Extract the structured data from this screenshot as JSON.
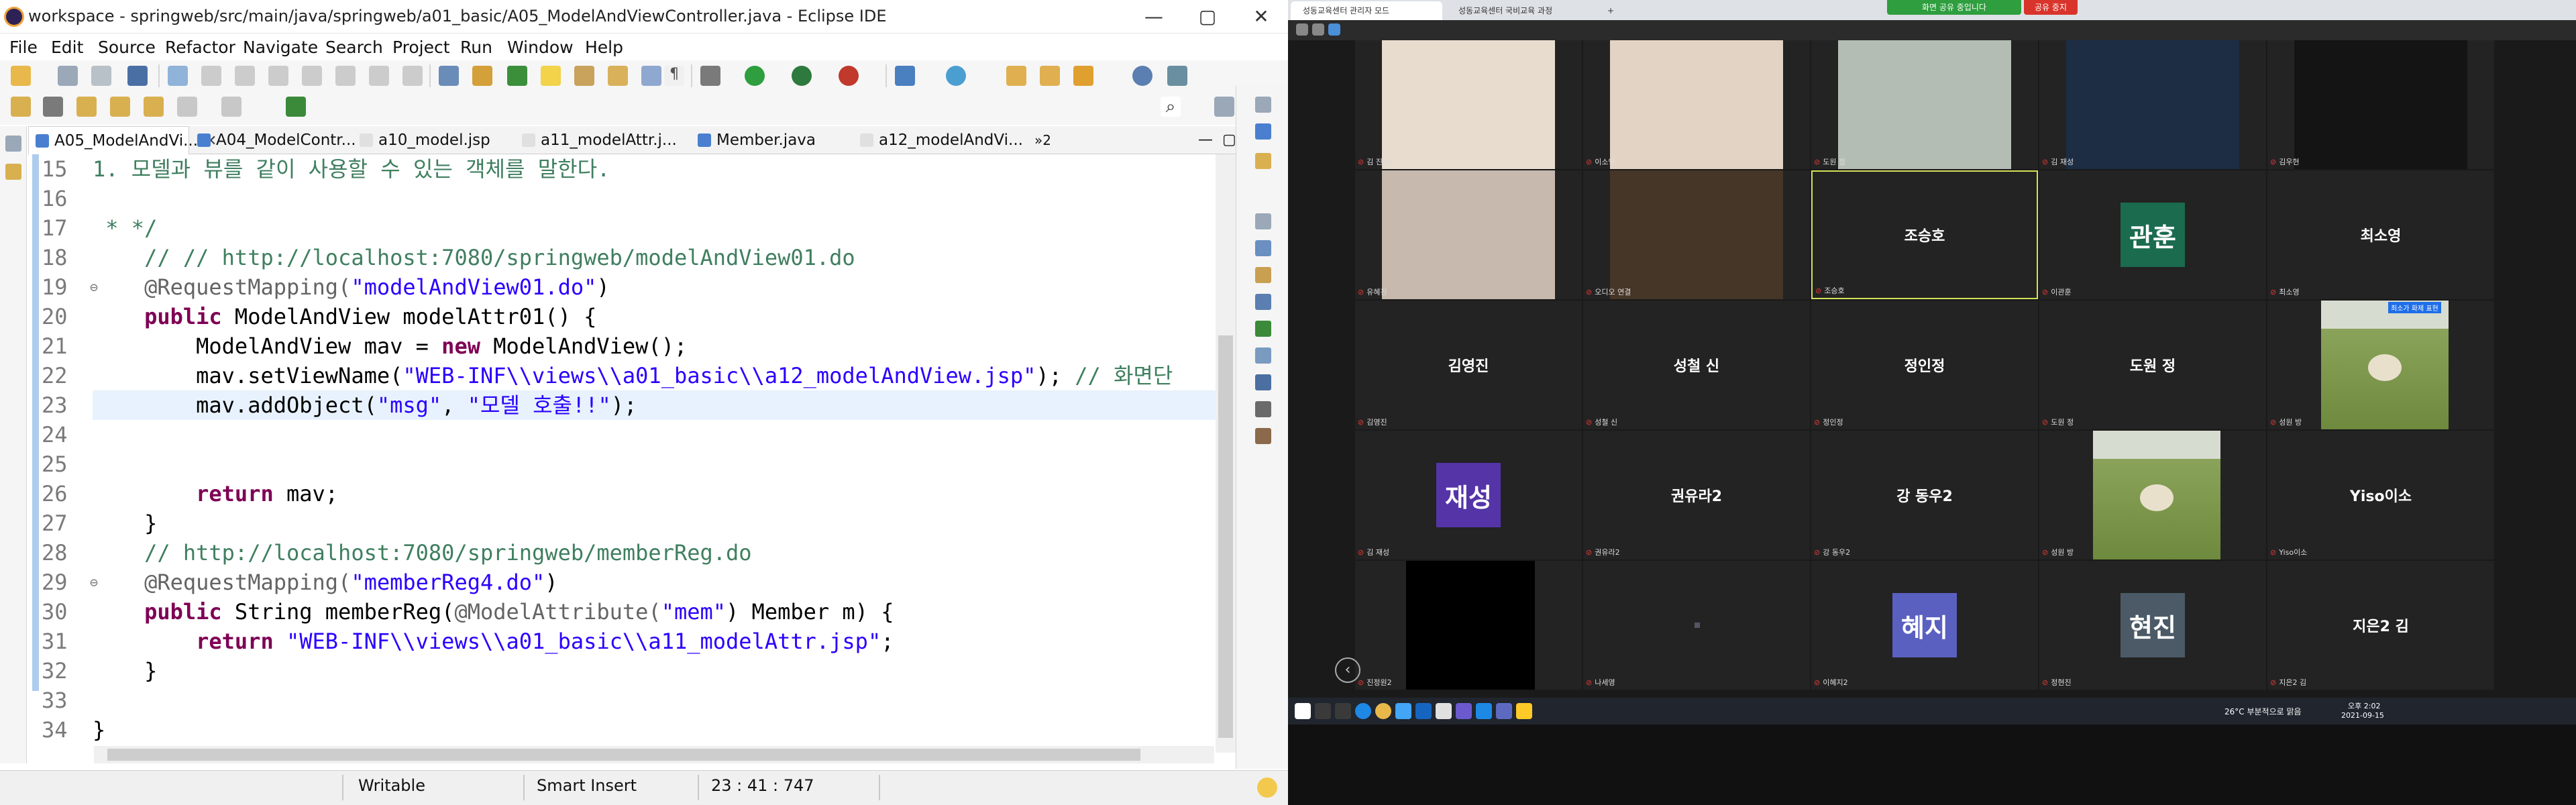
{
  "eclipse": {
    "window_title": "workspace - springweb/src/main/java/springweb/a01_basic/A05_ModelAndViewController.java - Eclipse IDE",
    "controls": {
      "minimize": "—",
      "maximize": "▢",
      "close": "✕"
    },
    "menu": [
      "File",
      "Edit",
      "Source",
      "Refactor",
      "Navigate",
      "Search",
      "Project",
      "Run",
      "Window",
      "Help"
    ],
    "tabs": [
      {
        "label": "A05_ModelAndVi...",
        "active": true
      },
      {
        "label": "A04_ModelContr..."
      },
      {
        "label": "a10_model.jsp"
      },
      {
        "label": "a11_modelAttr.j..."
      },
      {
        "label": "Member.java"
      },
      {
        "label": "a12_modelAndVi..."
      }
    ],
    "tab_overflow": "»2",
    "code": {
      "lines": [
        {
          "no": "15",
          "parts": [
            {
              "t": "1. 모델과 뷰를 같이 사용할 수 있는 객체를 말한다.",
              "c": "cm"
            }
          ]
        },
        {
          "no": "16",
          "parts": []
        },
        {
          "no": "17",
          "parts": [
            {
              "t": " * */",
              "c": "cm"
            }
          ]
        },
        {
          "no": "18",
          "parts": [
            {
              "t": "    // // http://localhost:7080/springweb/modelAndView01.do",
              "c": "cm"
            }
          ]
        },
        {
          "no": "19",
          "fold": "⊖",
          "parts": [
            {
              "t": "    @RequestMapping(",
              "c": "ann"
            },
            {
              "t": "\"modelAndView01.do\"",
              "c": "str"
            },
            {
              "t": ")",
              "c": ""
            }
          ]
        },
        {
          "no": "20",
          "parts": [
            {
              "t": "    ",
              "c": ""
            },
            {
              "t": "public",
              "c": "kw"
            },
            {
              "t": " ModelAndView modelAttr01() {",
              "c": ""
            }
          ]
        },
        {
          "no": "21",
          "parts": [
            {
              "t": "        ModelAndView mav = ",
              "c": ""
            },
            {
              "t": "new",
              "c": "kw"
            },
            {
              "t": " ModelAndView();",
              "c": ""
            }
          ]
        },
        {
          "no": "22",
          "parts": [
            {
              "t": "        mav.setViewName(",
              "c": ""
            },
            {
              "t": "\"WEB-INF\\\\views\\\\a01_basic\\\\a12_modelAndView.jsp\"",
              "c": "str"
            },
            {
              "t": "); ",
              "c": ""
            },
            {
              "t": "// 화면단",
              "c": "cm"
            }
          ]
        },
        {
          "no": "23",
          "highlight": true,
          "parts": [
            {
              "t": "        mav.addObject(",
              "c": ""
            },
            {
              "t": "\"msg\"",
              "c": "str"
            },
            {
              "t": ", ",
              "c": ""
            },
            {
              "t": "\"모델 호출!!\"",
              "c": "str"
            },
            {
              "t": ");",
              "c": ""
            }
          ]
        },
        {
          "no": "24",
          "parts": []
        },
        {
          "no": "25",
          "parts": []
        },
        {
          "no": "26",
          "parts": [
            {
              "t": "        ",
              "c": ""
            },
            {
              "t": "return",
              "c": "kw"
            },
            {
              "t": " mav;",
              "c": ""
            }
          ]
        },
        {
          "no": "27",
          "parts": [
            {
              "t": "    }",
              "c": ""
            }
          ]
        },
        {
          "no": "28",
          "parts": [
            {
              "t": "    // http://localhost:7080/springweb/memberReg.do",
              "c": "cm"
            }
          ]
        },
        {
          "no": "29",
          "fold": "⊖",
          "parts": [
            {
              "t": "    @RequestMapping(",
              "c": "ann"
            },
            {
              "t": "\"memberReg4.do\"",
              "c": "str"
            },
            {
              "t": ")",
              "c": ""
            }
          ]
        },
        {
          "no": "30",
          "parts": [
            {
              "t": "    ",
              "c": ""
            },
            {
              "t": "public",
              "c": "kw"
            },
            {
              "t": " String memberReg(",
              "c": ""
            },
            {
              "t": "@ModelAttribute(",
              "c": "ann"
            },
            {
              "t": "\"mem\"",
              "c": "str"
            },
            {
              "t": ") Member m) {",
              "c": ""
            }
          ]
        },
        {
          "no": "31",
          "parts": [
            {
              "t": "        ",
              "c": ""
            },
            {
              "t": "return",
              "c": "kw"
            },
            {
              "t": " ",
              "c": ""
            },
            {
              "t": "\"WEB-INF\\\\views\\\\a01_basic\\\\a11_modelAttr.jsp\"",
              "c": "str"
            },
            {
              "t": ";",
              "c": ""
            }
          ]
        },
        {
          "no": "32",
          "parts": [
            {
              "t": "    }",
              "c": ""
            }
          ]
        },
        {
          "no": "33",
          "parts": []
        },
        {
          "no": "34",
          "parts": [
            {
              "t": "}",
              "c": ""
            }
          ]
        }
      ]
    },
    "status": {
      "mode": "Writable",
      "insert": "Smart Insert",
      "position": "23 : 41 : 747"
    }
  },
  "zoom": {
    "browser_tabs": [
      {
        "label": "성동교육센터 관리자 모드"
      },
      {
        "label": "성동교육센터 국비교육 과정"
      }
    ],
    "share_text": "화면 공유 중입니다",
    "stop_share": "공유 중지",
    "spotlight_badge": "최소가 화제 표현",
    "participants": [
      {
        "label": "김 진성",
        "kind": "photo",
        "photo_color": "#e8dccf"
      },
      {
        "label": "이소영",
        "kind": "photo",
        "photo_color": "#e3d3c4"
      },
      {
        "label": "도원 정",
        "kind": "photo",
        "photo_color": "#b4bdb4"
      },
      {
        "label": "김 재성",
        "kind": "photo",
        "photo_color": "#1c2d44"
      },
      {
        "label": "김우현",
        "kind": "photo",
        "photo_color": "#141414"
      },
      {
        "label": "유혜진",
        "kind": "photo",
        "photo_color": "#c7b9ad"
      },
      {
        "label": "오디오 연결",
        "kind": "photo",
        "photo_color": "#463627"
      },
      {
        "label": "조승호",
        "kind": "name",
        "name": "조승호",
        "active": true
      },
      {
        "label": "이관훈",
        "kind": "avatar",
        "name": "관훈",
        "avatar_color": "#1b6b4f"
      },
      {
        "label": "최소영",
        "kind": "name",
        "name": "최소영"
      },
      {
        "label": "김영진",
        "kind": "name",
        "name": "김영진"
      },
      {
        "label": "성철 신",
        "kind": "name",
        "name": "성철 신"
      },
      {
        "label": "정인정",
        "kind": "name",
        "name": "정인정"
      },
      {
        "label": "도원 정",
        "kind": "name",
        "name": "도원 정"
      },
      {
        "label": "성원 방",
        "kind": "sheep"
      },
      {
        "label": "김 재성",
        "kind": "avatar",
        "name": "재성",
        "avatar_color": "#5534a8"
      },
      {
        "label": "권유라2",
        "kind": "name",
        "name": "권유라2"
      },
      {
        "label": "강 동우2",
        "kind": "name",
        "name": "강 동우2"
      },
      {
        "label": "성원 방",
        "kind": "sheep"
      },
      {
        "label": "Yiso이소",
        "kind": "name",
        "name": "Yiso이소"
      },
      {
        "label": "진정원2",
        "kind": "black"
      },
      {
        "label": "나세영",
        "kind": "dot"
      },
      {
        "label": "이혜지2",
        "kind": "avatar",
        "name": "혜지",
        "avatar_color": "#5a60c0"
      },
      {
        "label": "정현진",
        "kind": "avatar",
        "name": "현진",
        "avatar_color": "#4b5a66"
      },
      {
        "label": "지은2 김",
        "kind": "name",
        "name": "지은2 김"
      }
    ],
    "tray": {
      "weather": "26°C 부분적으로 맑음",
      "time": "오후 2:02",
      "date": "2021-09-15"
    }
  }
}
